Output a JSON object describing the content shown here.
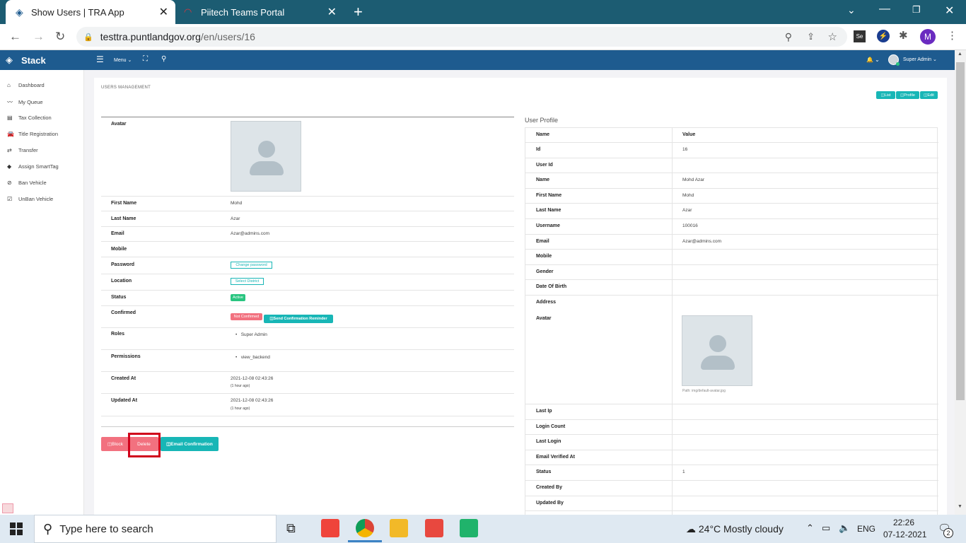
{
  "browser": {
    "tabs": [
      {
        "title": "Show Users | TRA App"
      },
      {
        "title": "Piitech Teams Portal"
      }
    ],
    "url_host": "testtra.puntlandgov.org",
    "url_path": "/en/users/16",
    "profile_initial": "M"
  },
  "app": {
    "brand": "Stack",
    "menu_label": "Menu",
    "user_label": "Super Admin"
  },
  "sidebar": {
    "items": [
      {
        "label": "Dashboard"
      },
      {
        "label": "My Queue"
      },
      {
        "label": "Tax Collection"
      },
      {
        "label": "Title Registration"
      },
      {
        "label": "Transfer"
      },
      {
        "label": "Assign SmartTag"
      },
      {
        "label": "Ban Vehicle"
      },
      {
        "label": "UnBan Vehicle"
      }
    ]
  },
  "page": {
    "section_title": "USERS MANAGEMENT",
    "top_buttons": {
      "list": "List",
      "profile": "Profile",
      "edit": "Edit"
    }
  },
  "left": {
    "rows": {
      "avatar": "Avatar",
      "first_name": {
        "label": "First Name",
        "value": "Mohd"
      },
      "last_name": {
        "label": "Last Name",
        "value": "Azar"
      },
      "email": {
        "label": "Email",
        "value": "Azar@admins.com"
      },
      "mobile": {
        "label": "Mobile",
        "value": ""
      },
      "password": {
        "label": "Password",
        "button": "Change password"
      },
      "location": {
        "label": "Location",
        "button": "Select District"
      },
      "status": {
        "label": "Status",
        "badge": "Active"
      },
      "confirmed": {
        "label": "Confirmed",
        "badge": "Not Confirmed",
        "button": "Send Confirmation Reminder"
      },
      "roles": {
        "label": "Roles",
        "value": "Super Admin"
      },
      "permissions": {
        "label": "Permissions",
        "value": "view_backend"
      },
      "created_at": {
        "label": "Created At",
        "value": "2021-12-08 02:43:26",
        "ago": "(1 hour ago)"
      },
      "updated_at": {
        "label": "Updated At",
        "value": "2021-12-08 02:43:26",
        "ago": "(1 hour ago)"
      }
    },
    "actions": {
      "block": "Block",
      "delete": "Delete",
      "email_confirmation": "Email Confirmation"
    }
  },
  "profile": {
    "title": "User Profile",
    "header": {
      "name": "Name",
      "value": "Value"
    },
    "rows": [
      {
        "name": "Id",
        "value": "16"
      },
      {
        "name": "User Id",
        "value": ""
      },
      {
        "name": "Name",
        "value": "Mohd Azar"
      },
      {
        "name": "First Name",
        "value": "Mohd"
      },
      {
        "name": "Last Name",
        "value": "Azar"
      },
      {
        "name": "Username",
        "value": "100016"
      },
      {
        "name": "Email",
        "value": "Azar@admins.com"
      },
      {
        "name": "Mobile",
        "value": ""
      },
      {
        "name": "Gender",
        "value": ""
      },
      {
        "name": "Date Of Birth",
        "value": ""
      },
      {
        "name": "Address",
        "value": ""
      }
    ],
    "avatar_label": "Avatar",
    "avatar_path": "Path: img/default-avatar.jpg",
    "rows_after": [
      {
        "name": "Last Ip",
        "value": ""
      },
      {
        "name": "Login Count",
        "value": ""
      },
      {
        "name": "Last Login",
        "value": ""
      },
      {
        "name": "Email Verified At",
        "value": ""
      },
      {
        "name": "Status",
        "value": "1"
      },
      {
        "name": "Created By",
        "value": ""
      },
      {
        "name": "Updated By",
        "value": ""
      }
    ]
  },
  "taskbar": {
    "search_placeholder": "Type here to search",
    "weather": "24°C  Mostly cloudy",
    "lang": "ENG",
    "time": "22:26",
    "date": "07-12-2021",
    "notif_count": "2"
  },
  "colors": {
    "chrome_tab_bar": "#1c5c72",
    "app_bar": "#1e5b8f",
    "teal": "#18b6b6",
    "danger": "#f2717f",
    "highlight": "#d0021b",
    "success": "#29c580"
  }
}
